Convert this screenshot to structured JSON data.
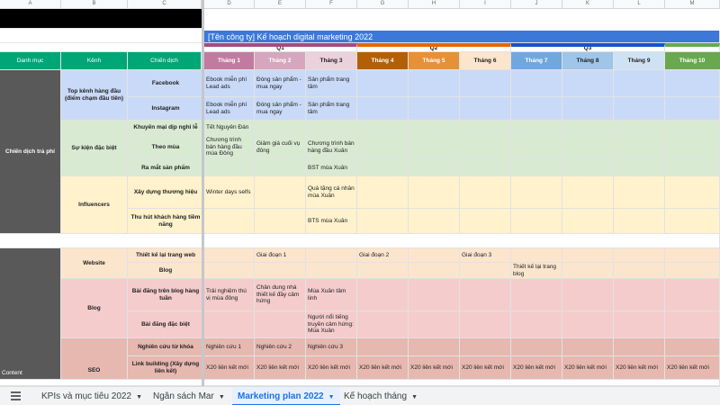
{
  "column_letters": [
    "A",
    "B",
    "C",
    "D",
    "E",
    "F",
    "G",
    "H",
    "I",
    "J",
    "K",
    "L",
    "M"
  ],
  "title": "[Tên công ty] Kế hoạch digital marketing 2022",
  "quarters": [
    "Q1",
    "Q2",
    "Q3"
  ],
  "headers": {
    "category": "Danh mục",
    "channel": "Kênh",
    "campaign": "Chiến dịch",
    "months": [
      "Tháng 1",
      "Tháng 2",
      "Tháng 3",
      "Tháng 4",
      "Tháng 5",
      "Tháng 6",
      "Tháng 7",
      "Tháng 8",
      "Tháng 9",
      "Tháng 10"
    ]
  },
  "categories": {
    "paid": "Chiến dịch trả phí",
    "content": "Content"
  },
  "channels": {
    "top": "Top kênh hàng đầu (điểm chạm đầu tiên)",
    "events": "Sự kiện đặc biệt",
    "influencers": "Influencers",
    "website": "Website",
    "blog": "Blog",
    "seo": "SEO"
  },
  "campaigns": {
    "facebook": "Facebook",
    "instagram": "Instagram",
    "holiday": "Khuyến mại dịp nghỉ lễ",
    "seasonal": "Theo mùa",
    "launch": "Ra mắt sản phẩm",
    "branding": "Xây dựng thương hiệu",
    "attract": "Thu hút khách hàng tiềm năng",
    "redesign": "Thiết kế lại trang web",
    "blog": "Blog",
    "top_posts": "Bài đăng trên blog hàng tuần",
    "special_posts": "Bài đăng đặc biệt",
    "keywords": "Nghiên cứu từ khóa",
    "links": "Link building (Xây dựng liên kết)"
  },
  "cells": {
    "fb_m1": "Ebook miễn phí Lead ads",
    "fb_m2": "Đóng sản phẩm - mua ngay",
    "fb_m3": "Sản phẩm trang tâm",
    "ig_m1": "Ebook miễn phí Lead ads",
    "ig_m2": "Đóng sản phẩm - mua ngay",
    "ig_m3": "Sản phẩm trang tâm",
    "holiday_m1": "Tết Nguyên Đán",
    "season_m1": "Chương trình bán hàng đầu mùa Đông",
    "season_m2": "Giảm giá cuối vụ đông",
    "season_m3": "Chương trình bán hàng đầu Xuân",
    "launch_m3": "BST mùa Xuân",
    "brand_m1": "Winter days selfs",
    "brand_m3": "Quà tặng cá nhân mùa Xuân",
    "attract_m3": "BTS mùa Xuân",
    "redesign_m2": "Giai đoạn 1",
    "redesign_m4": "Giai đoạn 2",
    "redesign_m6": "Giai đoạn 3",
    "blog_m7": "Thiết kế lại trang blog",
    "weekly_m1": "Trải nghiệm thú vị mùa đông",
    "weekly_m2": "Chân dung nhà thiết kế đầy cảm hứng",
    "weekly_m3": "Mùa Xuân tâm linh",
    "special_m3": "Người nổi tiếng truyền cảm hứng: Mùa Xuân",
    "kw_m1": "Nghiên cứu 1",
    "kw_m2": "Nghiên cứu 2",
    "kw_m3": "Nghiên cứu 3",
    "links_repeat": "X20 liên kết mới"
  },
  "tabs": [
    {
      "label": "KPIs và mục tiêu 2022"
    },
    {
      "label": "Ngân sách Mar"
    },
    {
      "label": "Marketing plan 2022"
    },
    {
      "label": "Kế hoạch tháng"
    }
  ],
  "colors": {
    "quarter1": "#a64d79",
    "quarter2": "#e06900",
    "quarter3": "#1155cc",
    "title_bar": "#3c78d8",
    "header_green": "#00a676",
    "paid_band": "#595959"
  }
}
